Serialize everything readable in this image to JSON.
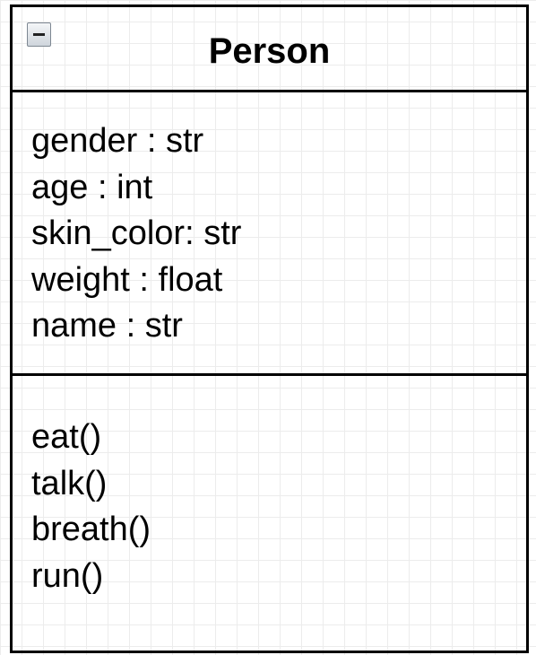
{
  "class": {
    "name": "Person",
    "toggle_icon": "minus-icon",
    "attributes": [
      "gender : str",
      "age : int",
      "skin_color: str",
      "weight : float",
      "name : str"
    ],
    "methods": [
      "eat()",
      "talk()",
      "breath()",
      "run()"
    ]
  },
  "colors": {
    "border": "#000000",
    "text": "#000000",
    "grid": "#dcdcdc",
    "toggle_fill": "#e4e8ec"
  }
}
